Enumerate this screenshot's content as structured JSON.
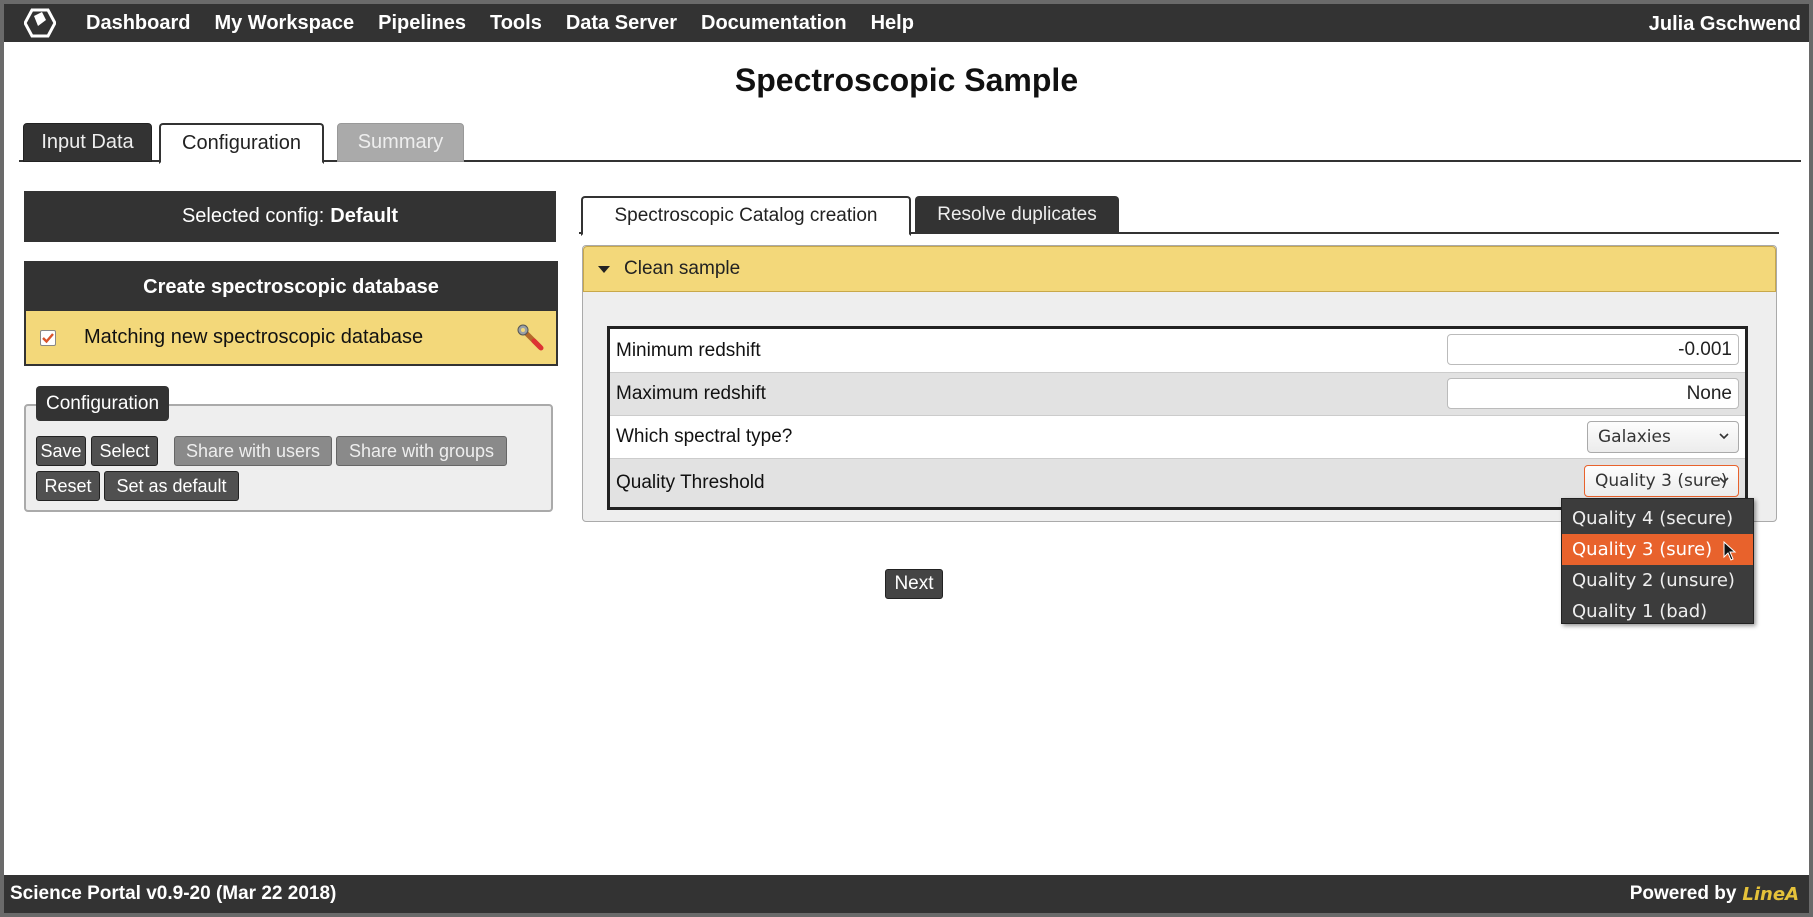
{
  "topbar": {
    "logo_icon": "hexagon-logo-icon",
    "nav": [
      "Dashboard",
      "My Workspace",
      "Pipelines",
      "Tools",
      "Data Server",
      "Documentation",
      "Help"
    ],
    "user": "Julia Gschwend"
  },
  "page_title": "Spectroscopic Sample",
  "main_tabs": [
    {
      "label": "Input Data",
      "state": "inactive"
    },
    {
      "label": "Configuration",
      "state": "active"
    },
    {
      "label": "Summary",
      "state": "disabled"
    }
  ],
  "sidebar": {
    "selected_config_label": "Selected config:",
    "selected_config_value": "Default",
    "create_db_title": "Create spectroscopic database",
    "matching_label": "Matching new spectroscopic database",
    "matching_checked": true,
    "config_legend": "Configuration",
    "buttons": {
      "save": "Save",
      "select": "Select",
      "share_users": "Share with users",
      "share_groups": "Share with groups",
      "reset": "Reset",
      "set_default": "Set as default"
    }
  },
  "sub_tabs": [
    {
      "label": "Spectroscopic Catalog creation",
      "state": "active"
    },
    {
      "label": "Resolve duplicates",
      "state": "inactive"
    }
  ],
  "panel": {
    "title": "Clean sample",
    "rows": [
      {
        "label": "Minimum redshift",
        "value": "-0.001"
      },
      {
        "label": "Maximum redshift",
        "value": "None"
      },
      {
        "label": "Which spectral type?",
        "value": "Galaxies"
      },
      {
        "label": "Quality Threshold",
        "value": "Quality 3 (sure)"
      }
    ]
  },
  "dropdown": {
    "options": [
      "Quality 4 (secure)",
      "Quality 3 (sure)",
      "Quality 2 (unsure)",
      "Quality 1 (bad)"
    ],
    "highlighted": 1
  },
  "next_label": "Next",
  "footer": {
    "version": "Science Portal v0.9-20 (Mar 22 2018)",
    "powered_by": "Powered by",
    "brand": "LineA"
  },
  "colors": {
    "dark": "#333333",
    "accent_yellow": "#f3d87a",
    "dropdown_highlight": "#e8622c",
    "brand_yellow": "#e5c23a"
  }
}
